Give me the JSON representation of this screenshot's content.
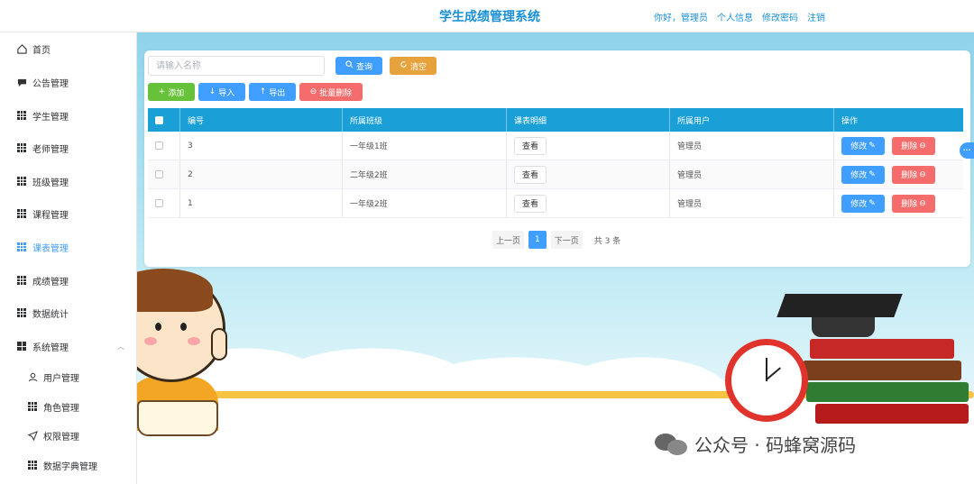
{
  "header": {
    "title": "学生成绩管理系统",
    "greeting": "你好，管理员",
    "profile": "个人信息",
    "change_password": "修改密码",
    "logout": "注销"
  },
  "sidebar": {
    "items": [
      {
        "label": "首页",
        "icon": "home-icon"
      },
      {
        "label": "公告管理",
        "icon": "message-icon"
      },
      {
        "label": "学生管理",
        "icon": "grid-icon"
      },
      {
        "label": "老师管理",
        "icon": "grid-icon"
      },
      {
        "label": "班级管理",
        "icon": "grid-icon"
      },
      {
        "label": "课程管理",
        "icon": "grid-icon"
      },
      {
        "label": "课表管理",
        "icon": "grid-icon",
        "active": true
      },
      {
        "label": "成绩管理",
        "icon": "grid-icon"
      },
      {
        "label": "数据统计",
        "icon": "grid-icon"
      },
      {
        "label": "系统管理",
        "icon": "menu-icon",
        "expanded": true
      },
      {
        "label": "用户管理",
        "icon": "user-icon"
      },
      {
        "label": "角色管理",
        "icon": "grid-icon"
      },
      {
        "label": "权限管理",
        "icon": "send-icon"
      },
      {
        "label": "数据字典管理",
        "icon": "grid-icon"
      }
    ]
  },
  "search": {
    "placeholder": "请输入名称",
    "query_label": "查询",
    "clear_label": "清空"
  },
  "toolbar": {
    "add_label": "添加",
    "import_label": "导入",
    "export_label": "导出",
    "batch_delete_label": "批量删除"
  },
  "table": {
    "columns": [
      "编号",
      "所属班级",
      "课表明细",
      "所属用户",
      "操作"
    ],
    "rows": [
      {
        "id": "3",
        "class": "一年级1班",
        "detail": "查看",
        "user": "管理员"
      },
      {
        "id": "2",
        "class": "二年级2班",
        "detail": "查看",
        "user": "管理员"
      },
      {
        "id": "1",
        "class": "一年级2班",
        "detail": "查看",
        "user": "管理员"
      }
    ],
    "edit_label": "修改",
    "delete_label": "删除"
  },
  "pagination": {
    "prev": "上一页",
    "current": "1",
    "next": "下一页",
    "total": "共 3 条"
  },
  "watermark": {
    "text": "公众号 · 码蜂窝源码"
  },
  "colors": {
    "primary": "#409eff",
    "header_title": "#1a8fd6",
    "table_head": "#1a9fd6",
    "success": "#67c23a",
    "warning": "#e6a23c",
    "danger": "#f56c6c"
  }
}
